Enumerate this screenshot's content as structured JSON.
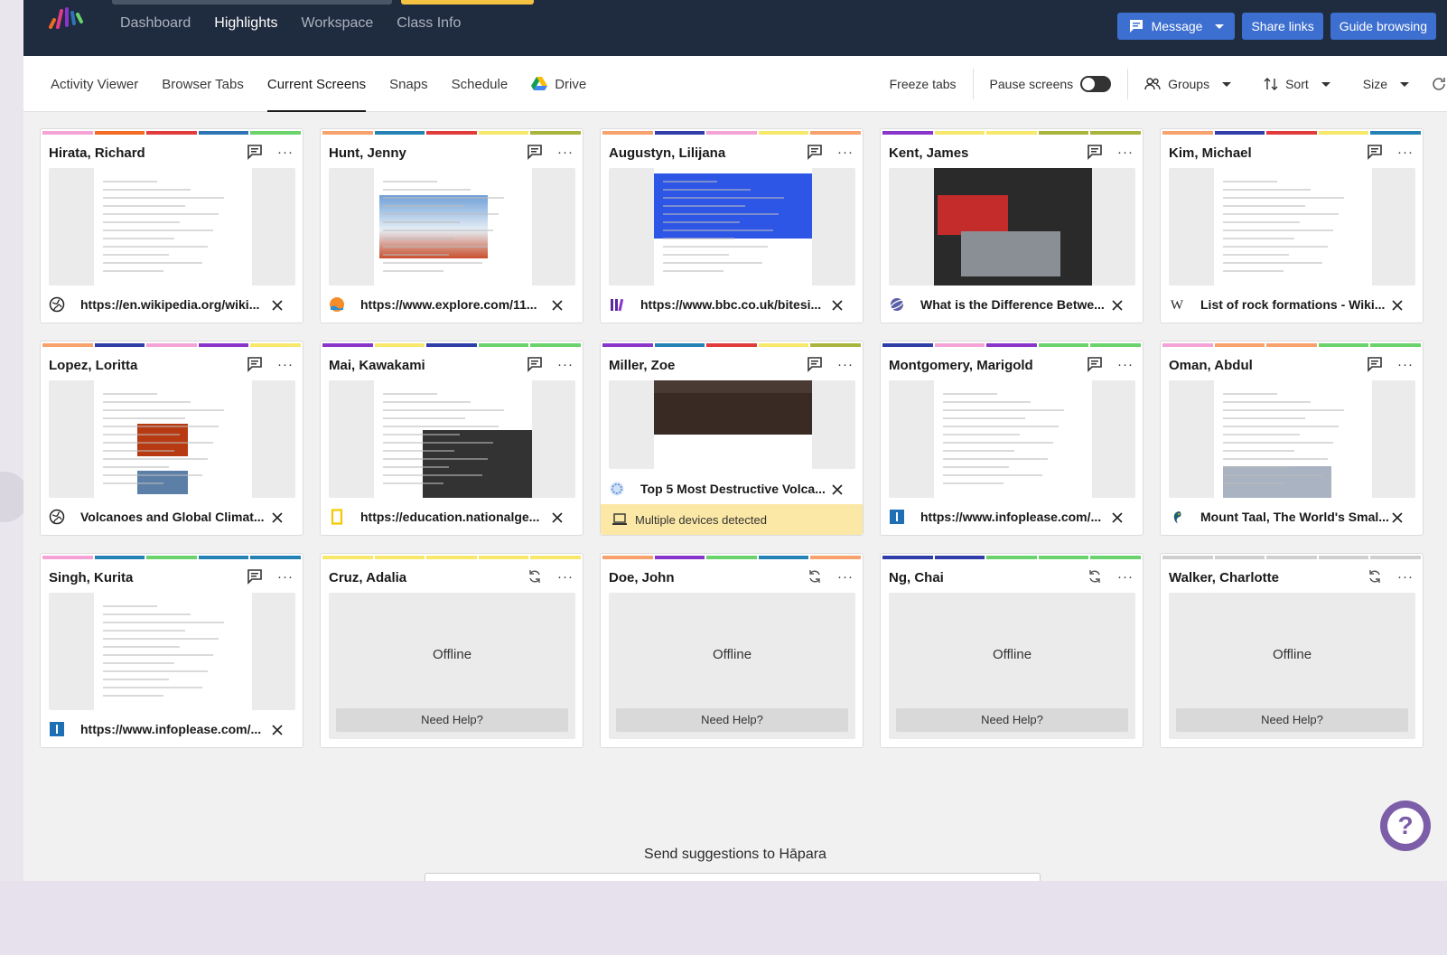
{
  "header": {
    "nav": [
      "Dashboard",
      "Highlights",
      "Workspace",
      "Class Info"
    ],
    "active_nav": "Highlights",
    "buttons": {
      "message": "Message",
      "share_links": "Share links",
      "guide_browsing": "Guide browsing"
    }
  },
  "toolbar": {
    "tabs": [
      "Activity Viewer",
      "Browser Tabs",
      "Current Screens",
      "Snaps",
      "Schedule",
      "Drive"
    ],
    "active_tab": "Current Screens",
    "freeze": "Freeze tabs",
    "pause": "Pause screens",
    "groups": "Groups",
    "sort": "Sort",
    "size": "Size"
  },
  "students": [
    {
      "name": "Hirata, Richard",
      "url": "https://en.wikipedia.org/wiki...",
      "favicon": "globe-icon",
      "bar": [
        "#f5a3d6",
        "#f26a24",
        "#e23b3b",
        "#2e74b5",
        "#6bd36b"
      ]
    },
    {
      "name": "Hunt, Jenny",
      "url": "https://www.explore.com/11...",
      "favicon": "explore-icon",
      "bar": [
        "#f7a26d",
        "#2582b5",
        "#e23b3b",
        "#f7e86b",
        "#a8b43c"
      ]
    },
    {
      "name": "Augustyn, Lilijana",
      "url": "https://www.bbc.co.uk/bitesi...",
      "favicon": "bitesize-icon",
      "bar": [
        "#f7a26d",
        "#2e3da8",
        "#f5a3d6",
        "#f7e86b",
        "#f7a26d"
      ]
    },
    {
      "name": "Kent, James",
      "url": "What is the Difference Betwe...",
      "favicon": "universe-icon",
      "bar": [
        "#8a35c9",
        "#f7e86b",
        "#f7e86b",
        "#a8b43c",
        "#a8b43c"
      ]
    },
    {
      "name": "Kim, Michael",
      "url": "List of rock formations - Wiki...",
      "favicon": "wikipedia-icon",
      "bar": [
        "#f7a26d",
        "#2e3da8",
        "#e23b3b",
        "#f7e86b",
        "#2582b5"
      ]
    },
    {
      "name": "Lopez, Loritta",
      "url": "Volcanoes and Global Climat...",
      "favicon": "globe-icon",
      "bar": [
        "#f7a26d",
        "#2e3da8",
        "#f5a3d6",
        "#8a35c9",
        "#f7e86b"
      ]
    },
    {
      "name": "Mai, Kawakami",
      "url": "https://education.nationalge...",
      "favicon": "natgeo-icon",
      "bar": [
        "#8a35c9",
        "#f7e86b",
        "#2e3da8",
        "#6bd36b",
        "#6bd36b"
      ]
    },
    {
      "name": "Miller, Zoe",
      "url": "Top 5 Most Destructive Volca...",
      "favicon": "spiral-icon",
      "bar": [
        "#8a35c9",
        "#2582b5",
        "#e23b3b",
        "#f7e86b",
        "#a8b43c"
      ],
      "note": "Multiple devices detected"
    },
    {
      "name": "Montgomery, Marigold",
      "url": "https://www.infoplease.com/...",
      "favicon": "infoplease-icon",
      "bar": [
        "#2e3da8",
        "#f5a3d6",
        "#8a35c9",
        "#6bd36b",
        "#6bd36b"
      ]
    },
    {
      "name": "Oman, Abdul",
      "url": "Mount Taal, The World's Smal...",
      "favicon": "parrot-icon",
      "bar": [
        "#f5a3d6",
        "#f7a26d",
        "#f7a26d",
        "#6bd36b",
        "#6bd36b"
      ]
    },
    {
      "name": "Singh, Kurita",
      "url": "https://www.infoplease.com/...",
      "favicon": "infoplease-icon",
      "bar": [
        "#f5a3d6",
        "#2582b5",
        "#6bd36b",
        "#2582b5",
        "#2582b5"
      ]
    },
    {
      "name": "Cruz, Adalia",
      "offline": true,
      "bar": [
        "#f7e86b",
        "#f7e86b",
        "#f7e86b",
        "#f7e86b",
        "#f7e86b"
      ]
    },
    {
      "name": "Doe, John",
      "offline": true,
      "bar": [
        "#f7a26d",
        "#8a35c9",
        "#6bd36b",
        "#2582b5",
        "#f7a26d"
      ]
    },
    {
      "name": "Ng, Chai",
      "offline": true,
      "bar": [
        "#2e3da8",
        "#2e3da8",
        "#6bd36b",
        "#6bd36b",
        "#6bd36b"
      ]
    },
    {
      "name": "Walker, Charlotte",
      "offline": true,
      "bar": [
        "#cfcfcf",
        "#cfcfcf",
        "#cfcfcf",
        "#cfcfcf",
        "#cfcfcf"
      ]
    }
  ],
  "offline_text": "Offline",
  "need_help": "Need Help?",
  "footer": {
    "suggest": "Send suggestions to Hāpara"
  }
}
